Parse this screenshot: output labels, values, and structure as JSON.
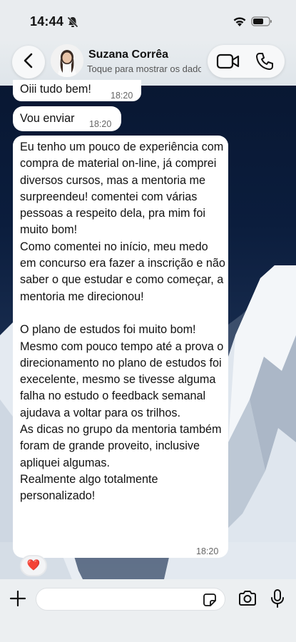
{
  "status_bar": {
    "time": "14:44",
    "icons": [
      "bell-slash-icon",
      "wifi-icon",
      "battery-icon"
    ]
  },
  "header": {
    "contact_name": "Suzana Corrêa",
    "subtitle": "Toque para mostrar os dados do contato",
    "icons": [
      "chevron-left-icon",
      "video-camera-icon",
      "phone-icon"
    ]
  },
  "messages": [
    {
      "text": "Oiii tudo bem!",
      "time": "18:20"
    },
    {
      "text": "Vou enviar",
      "time": "18:20"
    },
    {
      "text": "Eu tenho um pouco de experiência com compra de material on-line, já comprei diversos cursos, mas a mentoria me surpreendeu! comentei com várias pessoas a respeito dela, pra mim foi muito bom!\nComo comentei no início, meu medo em concurso era fazer a inscrição e não saber o que estudar e como começar, a mentoria me direcionou!\n\nO plano de estudos foi muito bom! Mesmo com pouco tempo até a prova o direcionamento no plano de estudos foi execelente, mesmo se tivesse alguma falha no estudo o feedback semanal ajudava a voltar para os trilhos.\nAs dicas no grupo da mentoria também foram de grande proveito, inclusive apliquei algumas.\n Realmente algo totalmente personalizado!",
      "time": "18:20",
      "reaction": "❤️"
    }
  ],
  "input_bar": {
    "placeholder": "",
    "icons": [
      "plus-icon",
      "sticker-icon",
      "camera-icon",
      "microphone-icon"
    ]
  },
  "colors": {
    "bubble": "#ffffff",
    "header_bg": "#e8ecef",
    "wallpaper_top": "#07142c"
  }
}
